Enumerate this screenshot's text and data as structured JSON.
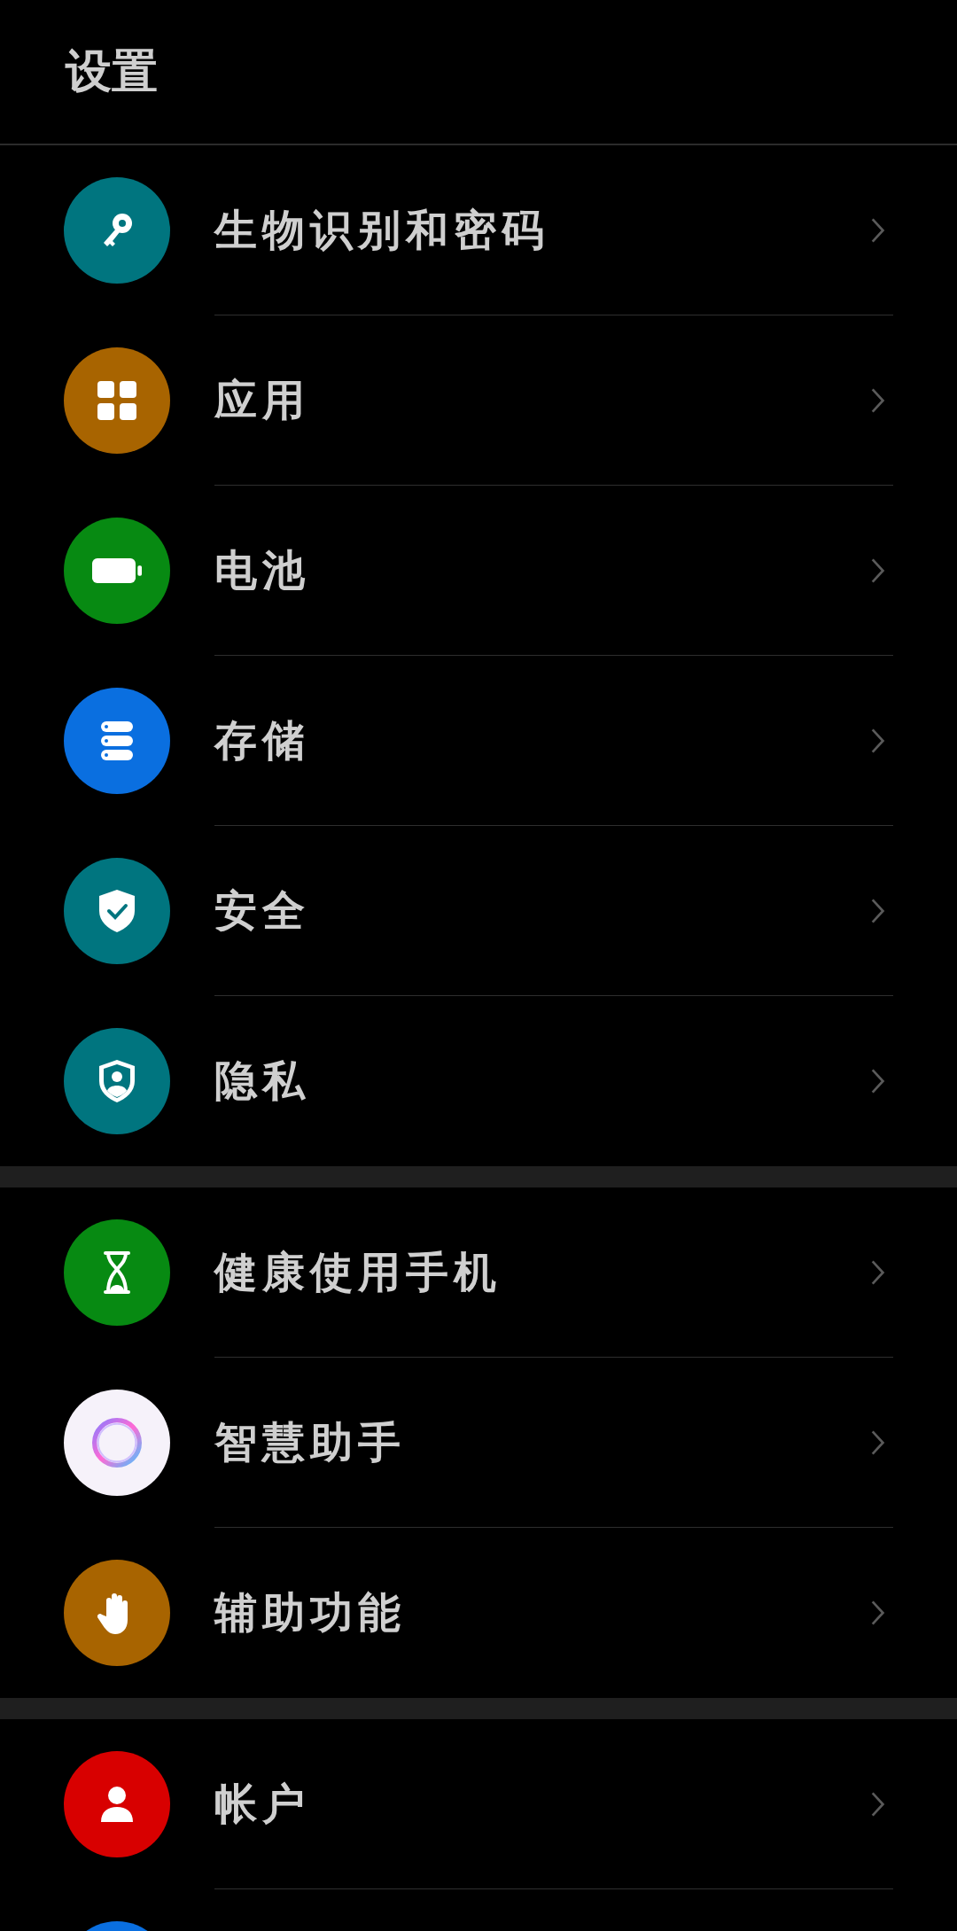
{
  "header": {
    "title": "设置"
  },
  "groups": [
    {
      "items": [
        {
          "kind": "key",
          "color": "#00757f",
          "label": "生物识别和密码"
        },
        {
          "kind": "grid",
          "color": "#a86400",
          "label": "应用"
        },
        {
          "kind": "battery",
          "color": "#078a12",
          "label": "电池"
        },
        {
          "kind": "storage",
          "color": "#0a6fe0",
          "label": "存储"
        },
        {
          "kind": "shieldcheck",
          "color": "#00757f",
          "label": "安全"
        },
        {
          "kind": "shieldperson",
          "color": "#00757f",
          "label": "隐私"
        }
      ]
    },
    {
      "items": [
        {
          "kind": "hourglass",
          "color": "#078a12",
          "label": "健康使用手机"
        },
        {
          "kind": "ring",
          "color": "#f6f2fa",
          "label": "智慧助手"
        },
        {
          "kind": "hand",
          "color": "#a86400",
          "label": "辅助功能"
        }
      ]
    },
    {
      "items": [
        {
          "kind": "person",
          "color": "#d80000",
          "label": "帐户"
        },
        {
          "kind": "circle",
          "color": "#0a6fe0"
        }
      ]
    }
  ]
}
